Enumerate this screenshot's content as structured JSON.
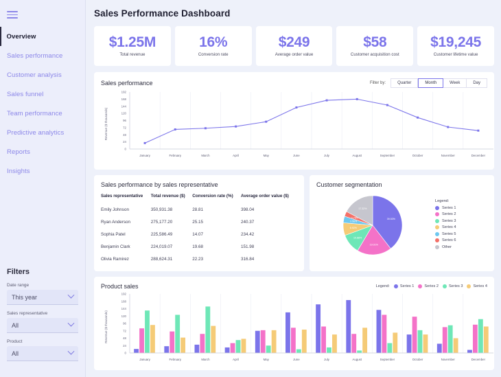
{
  "sidebar": {
    "menu_icon": "hamburger-icon",
    "items": [
      {
        "label": "Overview",
        "active": true
      },
      {
        "label": "Sales performance",
        "active": false
      },
      {
        "label": "Customer analysis",
        "active": false
      },
      {
        "label": "Sales funnel",
        "active": false
      },
      {
        "label": "Team performance",
        "active": false
      },
      {
        "label": "Predictive analytics",
        "active": false
      },
      {
        "label": "Reports",
        "active": false
      },
      {
        "label": "Insights",
        "active": false
      }
    ],
    "filters": {
      "title": "Filters",
      "fields": [
        {
          "label": "Date range",
          "value": "This year"
        },
        {
          "label": "Sales representative",
          "value": "All"
        },
        {
          "label": "Product",
          "value": "All"
        }
      ]
    }
  },
  "header": {
    "title": "Sales Performance Dashboard"
  },
  "kpis": [
    {
      "value": "$1.25M",
      "label": "Total revenue"
    },
    {
      "value": "16%",
      "label": "Conversion rate"
    },
    {
      "value": "$249",
      "label": "Average order value"
    },
    {
      "value": "$58",
      "label": "Customer acquisition cost"
    },
    {
      "value": "$19,245",
      "label": "Customer lifetime value"
    }
  ],
  "line_card": {
    "title": "Sales performance",
    "filter_label": "Filter by:",
    "pills": [
      {
        "label": "Quarter",
        "active": false
      },
      {
        "label": "Month",
        "active": true
      },
      {
        "label": "Week",
        "active": false
      },
      {
        "label": "Day",
        "active": false
      }
    ]
  },
  "table_card": {
    "title": "Sales performance by sales representative",
    "columns": [
      "Sales representative",
      "Total revenue ($)",
      "Conversion rate (%)",
      "Average order value ($)"
    ],
    "rows": [
      [
        "Emily Johnson",
        "350,931.38",
        "28.81",
        "398.04"
      ],
      [
        "Ryan Anderson",
        "275,177.20",
        "25.15",
        "240.37"
      ],
      [
        "Sophia Patel",
        "225,586.49",
        "14.07",
        "234.42"
      ],
      [
        "Benjamin Clark",
        "224,019.07",
        "19.68",
        "151.98"
      ],
      [
        "Olivia Ramirez",
        "288,624.31",
        "22.23",
        "316.84"
      ]
    ]
  },
  "pie_card": {
    "title": "Customer segmentation",
    "legend_title": "Legend:"
  },
  "bar_card": {
    "title": "Product sales",
    "legend_title": "Legend:"
  },
  "colors": {
    "accent": "#7b74ea",
    "series1": "#7b74ea",
    "series2": "#f472c8",
    "series3": "#6ee7b7",
    "series4": "#f5cb77",
    "series5": "#6ec8f0",
    "series6": "#f47068",
    "other": "#c6c6ce",
    "card_bg": "#ffffff",
    "page_bg": "#eef1fa",
    "sidebar_bg": "#eceefb"
  },
  "chart_data": [
    {
      "type": "line",
      "name": "sales-performance-line",
      "title": "Sales performance",
      "xlabel": "",
      "ylabel": "Revenue ($ thousands)",
      "categories": [
        "January",
        "February",
        "March",
        "April",
        "May",
        "June",
        "July",
        "August",
        "September",
        "October",
        "November",
        "December"
      ],
      "yticks": [
        0,
        24,
        48,
        72,
        96,
        120,
        144,
        168,
        192
      ],
      "ylim": [
        0,
        192
      ],
      "grid": true,
      "series": [
        {
          "name": "Revenue",
          "color": "#7b74ea",
          "values": [
            20,
            66,
            70,
            76,
            92,
            140,
            164,
            168,
            148,
            106,
            74,
            62
          ]
        }
      ]
    },
    {
      "type": "pie",
      "name": "customer-segmentation-pie",
      "title": "Customer segmentation",
      "legend_position": "right",
      "labels": [
        "Series 1",
        "Series 2",
        "Series 3",
        "Series 4",
        "Series 5",
        "Series 6",
        "Other"
      ],
      "values": [
        39.53,
        19.01,
        10.88,
        6.92,
        3.56,
        2.78,
        17.32
      ],
      "value_labels": [
        "39.53%",
        "19.01%",
        "10.88%",
        "6.92%",
        "3.56%",
        "2.78%",
        "17.32%"
      ],
      "colors": [
        "#7b74ea",
        "#f472c8",
        "#6ee7b7",
        "#f5cb77",
        "#6ec8f0",
        "#f47068",
        "#c6c6ce"
      ]
    },
    {
      "type": "bar",
      "name": "product-sales-bar",
      "title": "Product sales",
      "xlabel": "",
      "ylabel": "Revenue ($ thousands)",
      "categories": [
        "January",
        "February",
        "March",
        "April",
        "May",
        "June",
        "July",
        "August",
        "September",
        "October",
        "November",
        "December"
      ],
      "yticks": [
        0,
        24,
        48,
        72,
        96,
        120,
        144,
        168,
        192
      ],
      "ylim": [
        0,
        192
      ],
      "grid": true,
      "legend_position": "top-right",
      "series": [
        {
          "name": "Series 1",
          "color": "#7b74ea",
          "values": [
            13,
            22,
            27,
            18,
            72,
            132,
            158,
            172,
            140,
            60,
            30,
            10
          ]
        },
        {
          "name": "Series 2",
          "color": "#f472c8",
          "values": [
            80,
            70,
            62,
            32,
            74,
            82,
            86,
            62,
            124,
            118,
            84,
            92
          ]
        },
        {
          "name": "Series 3",
          "color": "#6ee7b7",
          "values": [
            138,
            124,
            151,
            42,
            24,
            12,
            18,
            8,
            32,
            74,
            90,
            110
          ]
        },
        {
          "name": "Series 4",
          "color": "#f5cb77",
          "values": [
            91,
            50,
            88,
            46,
            74,
            76,
            60,
            82,
            66,
            60,
            48,
            86
          ]
        }
      ]
    }
  ]
}
